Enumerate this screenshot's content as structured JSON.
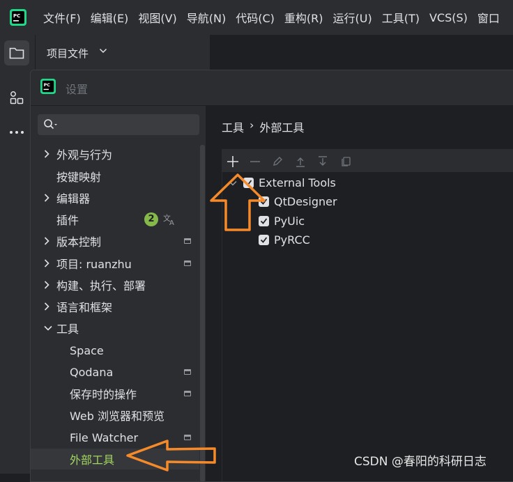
{
  "menubar": {
    "items": [
      "文件(F)",
      "编辑(E)",
      "视图(V)",
      "导航(N)",
      "代码(C)",
      "重构(R)",
      "运行(U)",
      "工具(T)",
      "VCS(S)",
      "窗口"
    ]
  },
  "project_panel": {
    "title": "项目文件"
  },
  "dialog": {
    "title": "设置",
    "sidebar": {
      "items": [
        {
          "label": "外观与行为"
        },
        {
          "label": "按键映射"
        },
        {
          "label": "编辑器"
        },
        {
          "label": "插件",
          "badge": "2"
        },
        {
          "label": "版本控制"
        },
        {
          "label": "项目: ruanzhu"
        },
        {
          "label": "构建、执行、部署"
        },
        {
          "label": "语言和框架"
        },
        {
          "label": "工具"
        },
        {
          "label": "Space"
        },
        {
          "label": "Qodana"
        },
        {
          "label": "保存时的操作"
        },
        {
          "label": "Web 浏览器和预览"
        },
        {
          "label": "File Watcher"
        },
        {
          "label": "外部工具"
        }
      ]
    },
    "breadcrumb": [
      "工具",
      "›",
      "外部工具"
    ],
    "tree": {
      "group": "External Tools",
      "children": [
        "QtDesigner",
        "PyUic",
        "PyRCC"
      ]
    }
  },
  "watermark": "CSDN @春阳的科研日志",
  "colors": {
    "annotation_arrow": "#f58a2a",
    "selected_text": "#a4d65e",
    "badge": "#85b94a"
  }
}
